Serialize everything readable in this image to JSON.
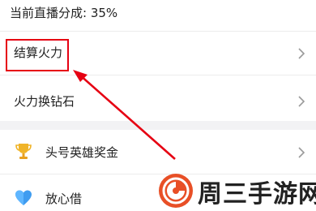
{
  "top_row": {
    "text": "当前直播分成: 35%"
  },
  "menu": {
    "settle_firepower": "结算火力",
    "exchange_diamond": "火力换钻石",
    "top_hero_bonus": "头号英雄奖金",
    "fangxin_borrow": "放心借"
  },
  "icons": {
    "chevron": "chevron-right-icon",
    "trophy": "trophy-icon",
    "heart": "heart-icon"
  },
  "watermark": {
    "text": "周三手游网"
  },
  "colors": {
    "annotation_red": "#e60012",
    "trophy_gold": "#f0b429",
    "heart_blue": "#3f9cf0"
  }
}
